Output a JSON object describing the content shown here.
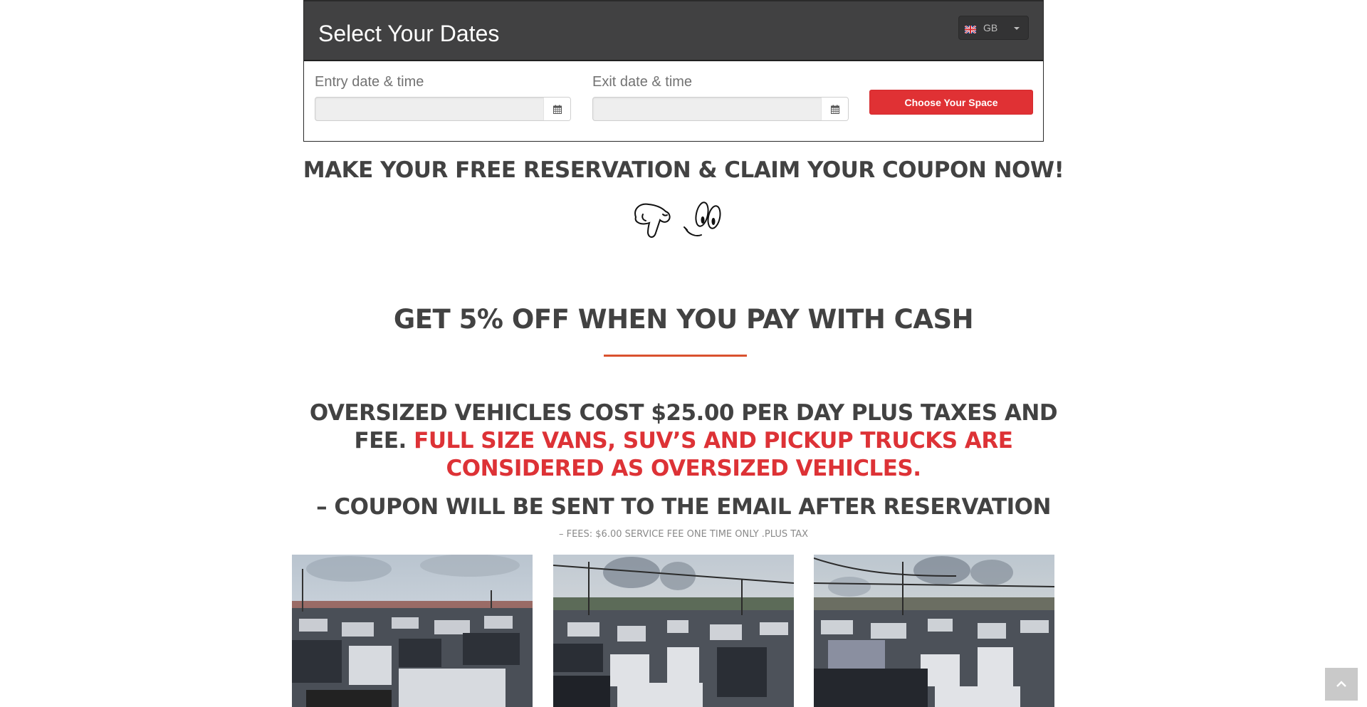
{
  "booking": {
    "title": "Select Your Dates",
    "language": {
      "selected": "GB",
      "icon": "uk-flag-icon"
    },
    "entry": {
      "label": "Entry date & time",
      "value": "",
      "placeholder": "",
      "icon": "calendar-icon"
    },
    "exit": {
      "label": "Exit date & time",
      "value": "",
      "placeholder": "",
      "icon": "calendar-icon"
    },
    "submit_label": "Choose Your Space"
  },
  "promo": {
    "reservation_headline": "MAKE YOUR FREE RESERVATION & CLAIM YOUR COUPON NOW!",
    "emoji_icons": [
      "pointing-down-hand-icon",
      "smiley-face-icon"
    ],
    "cash_headline": "GET 5% OFF WHEN YOU PAY WITH CASH",
    "oversized_dark": "OVERSIZED VEHICLES COST $25.00 PER DAY PLUS TAXES AND FEE. ",
    "oversized_red": "FULL SIZE VANS, SUV’S AND PICKUP TRUCKS ARE CONSIDERED AS OVERSIZED VEHICLES.",
    "coupon_headline": "– COUPON WILL BE SENT TO THE EMAIL AFTER RESERVATION",
    "fees_note": "– FEES: $6.00 SERVICE FEE ONE TIME ONLY .PLUS TAX"
  },
  "colors": {
    "header_bg": "#414142",
    "accent_red": "#e03134",
    "divider_orange": "#d9522e",
    "text_dark": "#424242"
  },
  "gallery": [
    {
      "alt": "Parking lot full of cars 1"
    },
    {
      "alt": "Parking lot full of cars 2"
    },
    {
      "alt": "Parking lot full of cars 3"
    }
  ],
  "scroll_top": {
    "icon": "chevron-up-icon"
  }
}
